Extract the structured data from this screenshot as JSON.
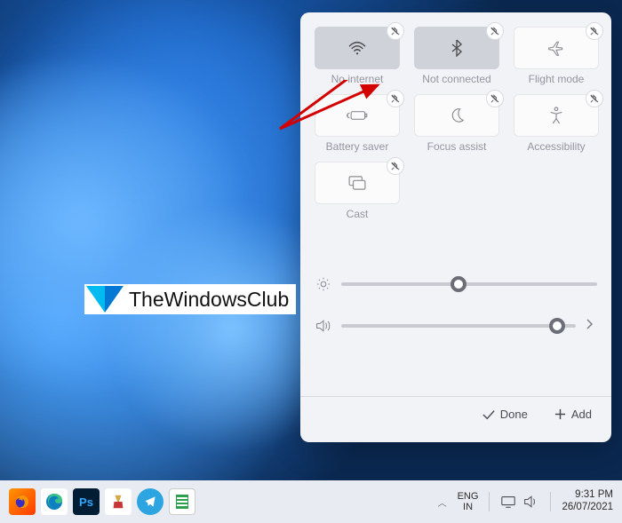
{
  "panel": {
    "tiles": [
      {
        "id": "wifi",
        "label": "No internet",
        "active": true,
        "icon": "wifi-icon"
      },
      {
        "id": "bluetooth",
        "label": "Not connected",
        "active": true,
        "icon": "bluetooth-icon"
      },
      {
        "id": "flight",
        "label": "Flight mode",
        "active": false,
        "icon": "airplane-icon"
      },
      {
        "id": "battery",
        "label": "Battery saver",
        "active": false,
        "icon": "battery-saver-icon"
      },
      {
        "id": "focus",
        "label": "Focus assist",
        "active": false,
        "icon": "moon-icon"
      },
      {
        "id": "accessibility",
        "label": "Accessibility",
        "active": false,
        "icon": "accessibility-icon"
      },
      {
        "id": "cast",
        "label": "Cast",
        "active": false,
        "icon": "cast-icon"
      }
    ],
    "sliders": {
      "brightness": 46,
      "volume": 92
    },
    "footer": {
      "done": "Done",
      "add": "Add"
    }
  },
  "watermark": {
    "text": "TheWindowsClub"
  },
  "taskbar": {
    "lang1": "ENG",
    "lang2": "IN",
    "time": "9:31 PM",
    "date": "26/07/2021"
  }
}
